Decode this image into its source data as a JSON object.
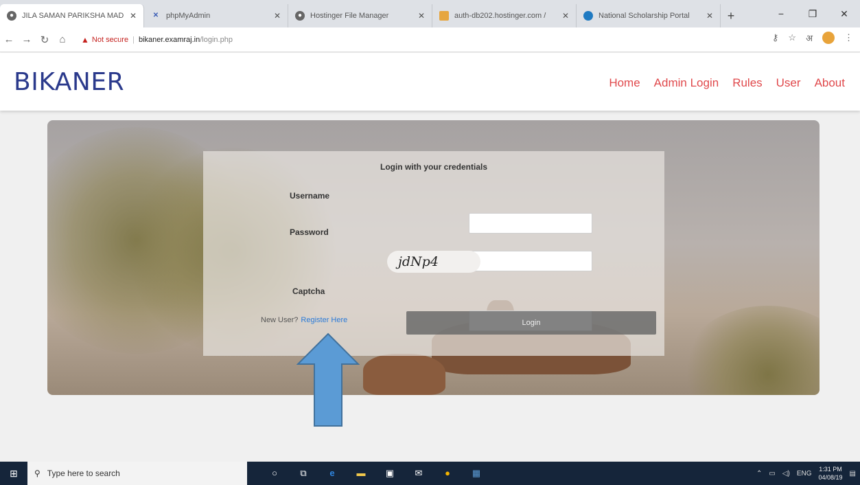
{
  "browser": {
    "tabs": [
      {
        "title": "JILA SAMAN PARIKSHA MAD"
      },
      {
        "title": "phpMyAdmin"
      },
      {
        "title": "Hostinger File Manager"
      },
      {
        "title": "auth-db202.hostinger.com / "
      },
      {
        "title": "National Scholarship Portal"
      }
    ],
    "new_tab": "+",
    "address": {
      "security_label": "Not secure",
      "host": "bikaner.examraj.in",
      "path": "/login.php"
    },
    "lang_icon": "अ"
  },
  "site": {
    "brand": "BIKANER",
    "nav": [
      "Home",
      "Admin Login",
      "Rules",
      "User",
      "About"
    ]
  },
  "login": {
    "title": "Login with your credentials",
    "username_label": "Username",
    "password_label": "Password",
    "captcha_text": "jdNp4",
    "captcha_label": "Captcha",
    "new_user_text": "New User?",
    "register_link": "Register Here",
    "login_button": "Login"
  },
  "taskbar": {
    "search_placeholder": "Type here to search",
    "lang": "ENG",
    "time": "1:31 PM",
    "date": "04/08/19"
  },
  "colors": {
    "brand": "#2b3a8c",
    "nav": "#e0484b",
    "arrow": "#5b9bd5"
  }
}
